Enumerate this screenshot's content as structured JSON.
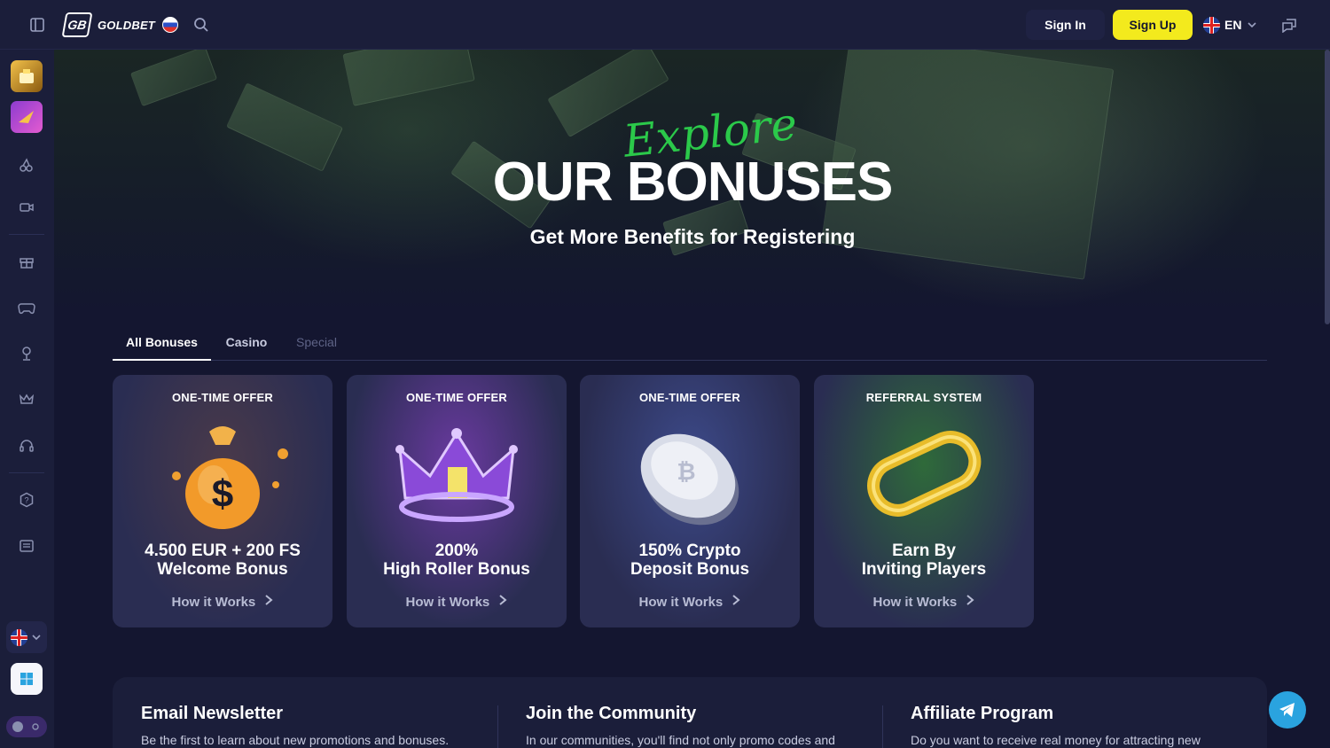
{
  "header": {
    "brand": "GOLDBET",
    "logo_mark": "GB",
    "sign_in": "Sign In",
    "sign_up": "Sign Up",
    "language": "EN"
  },
  "hero": {
    "script_title": "Explore",
    "title": "OUR BONUSES",
    "subtitle": "Get More Benefits for Registering"
  },
  "tabs": [
    {
      "label": "All Bonuses",
      "state": "active"
    },
    {
      "label": "Casino",
      "state": "normal"
    },
    {
      "label": "Special",
      "state": "disabled"
    }
  ],
  "cards": [
    {
      "tag": "ONE-TIME OFFER",
      "title_line1": "4.500 EUR + 200 FS",
      "title_line2": "Welcome Bonus",
      "link": "How it Works",
      "icon": "money-bag-icon"
    },
    {
      "tag": "ONE-TIME OFFER",
      "title_line1": "200%",
      "title_line2": "High Roller Bonus",
      "link": "How it Works",
      "icon": "crown-icon"
    },
    {
      "tag": "ONE-TIME OFFER",
      "title_line1": "150% Crypto",
      "title_line2": "Deposit Bonus",
      "link": "How it Works",
      "icon": "bitcoin-coin-icon"
    },
    {
      "tag": "REFERRAL SYSTEM",
      "title_line1": "Earn By",
      "title_line2": "Inviting Players",
      "link": "How it Works",
      "icon": "chain-link-icon"
    }
  ],
  "bottom": {
    "newsletter_title": "Email Newsletter",
    "newsletter_text": "Be the first to learn about new promotions and bonuses.",
    "community_title": "Join the Community",
    "community_text": "In our communities, you'll find not only promo codes and",
    "affiliate_title": "Affiliate Program",
    "affiliate_text": "Do you want to receive real money for attracting new"
  },
  "colors": {
    "accent_yellow": "#f3ea1d",
    "script_green": "#2bc94a",
    "telegram_blue": "#2aa3df"
  }
}
